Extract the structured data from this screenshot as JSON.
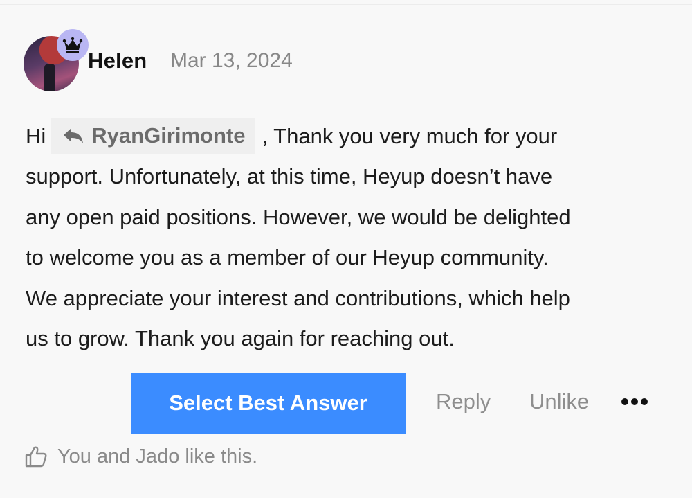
{
  "post": {
    "author": "Helen",
    "date": "Mar 13, 2024",
    "badge_icon": "crown-icon",
    "body": {
      "greeting": "Hi",
      "mention": "RyanGirimonte",
      "line1_rest": ", Thank you very much for your",
      "line2": "support. Unfortunately, at this time, Heyup doesn’t have",
      "line3": "any open paid positions. However, we would be delighted",
      "line4": "to welcome you as a member of our Heyup community.",
      "line5": "We appreciate your interest and contributions, which help",
      "line6": "us to grow. Thank you again for reaching out."
    }
  },
  "actions": {
    "best_answer_label": "Select Best Answer",
    "reply_label": "Reply",
    "unlike_label": "Unlike",
    "more_icon": "more-dots-icon"
  },
  "likes": {
    "icon": "thumbs-up-icon",
    "text": "You and Jado like this."
  },
  "colors": {
    "accent": "#3b8cff",
    "badge": "#b9b6f3",
    "muted_text": "#8e8e8e",
    "mention_bg": "#efefef"
  }
}
